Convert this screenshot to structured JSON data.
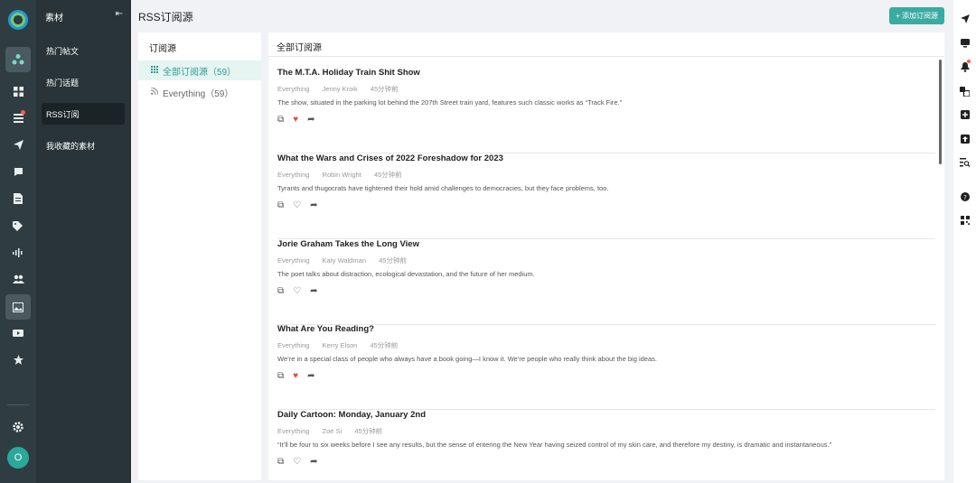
{
  "rail": {
    "icons": [
      "logo-icon",
      "dashboard-icon",
      "grid-icon",
      "list-icon",
      "send-icon",
      "chat-icon",
      "document-icon",
      "tag-icon",
      "audio-icon",
      "users-icon",
      "image-icon",
      "video-icon",
      "star-icon",
      "settings-icon"
    ],
    "avatar_initial": "O"
  },
  "menu": {
    "title": "素材",
    "collapse_glyph": "⇤",
    "items": [
      {
        "label": "热门帖文"
      },
      {
        "label": "热门话题"
      },
      {
        "label": "RSS订阅"
      },
      {
        "label": "我收藏的素材"
      }
    ]
  },
  "header": {
    "title": "RSS订阅源",
    "add_button": "+ 添加订阅源"
  },
  "feeds": {
    "title": "订阅源",
    "items": [
      {
        "label": "全部订阅源（59）"
      },
      {
        "label": "Everything（59）"
      }
    ]
  },
  "list": {
    "title": "全部订阅源",
    "articles": [
      {
        "title": "The M.T.A. Holiday Train Shit Show",
        "source": "Everything",
        "author": "Jenny Kroik",
        "time": "45分钟前",
        "desc": "The show, situated in the parking lot behind the 207th Street train yard, features such classic works as “Track Fire.”",
        "liked": true
      },
      {
        "title": "What the Wars and Crises of 2022 Foreshadow for 2023",
        "source": "Everything",
        "author": "Robin Wright",
        "time": "45分钟前",
        "desc": "Tyrants and thugocrats have tightened their hold amid challenges to democracies, but they face problems, too.",
        "liked": false
      },
      {
        "title": "Jorie Graham Takes the Long View",
        "source": "Everything",
        "author": "Katy Waldman",
        "time": "45分钟前",
        "desc": "The poet talks about distraction, ecological devastation, and the future of her medium.",
        "liked": false
      },
      {
        "title": "What Are You Reading?",
        "source": "Everything",
        "author": "Kerry Elson",
        "time": "45分钟前",
        "desc": "We’re in a special class of people who always have a book going—I know it. We’re people who really think about the big ideas.",
        "liked": true
      },
      {
        "title": "Daily Cartoon: Monday, January 2nd",
        "source": "Everything",
        "author": "Zoe Si",
        "time": "45分钟前",
        "desc": "“It’ll be four to six weeks before I see any results, but the sense of entering the New Year having seized control of my skin care, and therefore my destiny, is dramatic and instantaneous.”",
        "liked": false
      }
    ]
  },
  "tools": {
    "icons": [
      "navigate-icon",
      "monitor-icon",
      "bell-icon",
      "translate-icon",
      "plus-box-icon",
      "upload-box-icon",
      "search-list-icon",
      "help-icon",
      "qrcode-icon"
    ]
  }
}
